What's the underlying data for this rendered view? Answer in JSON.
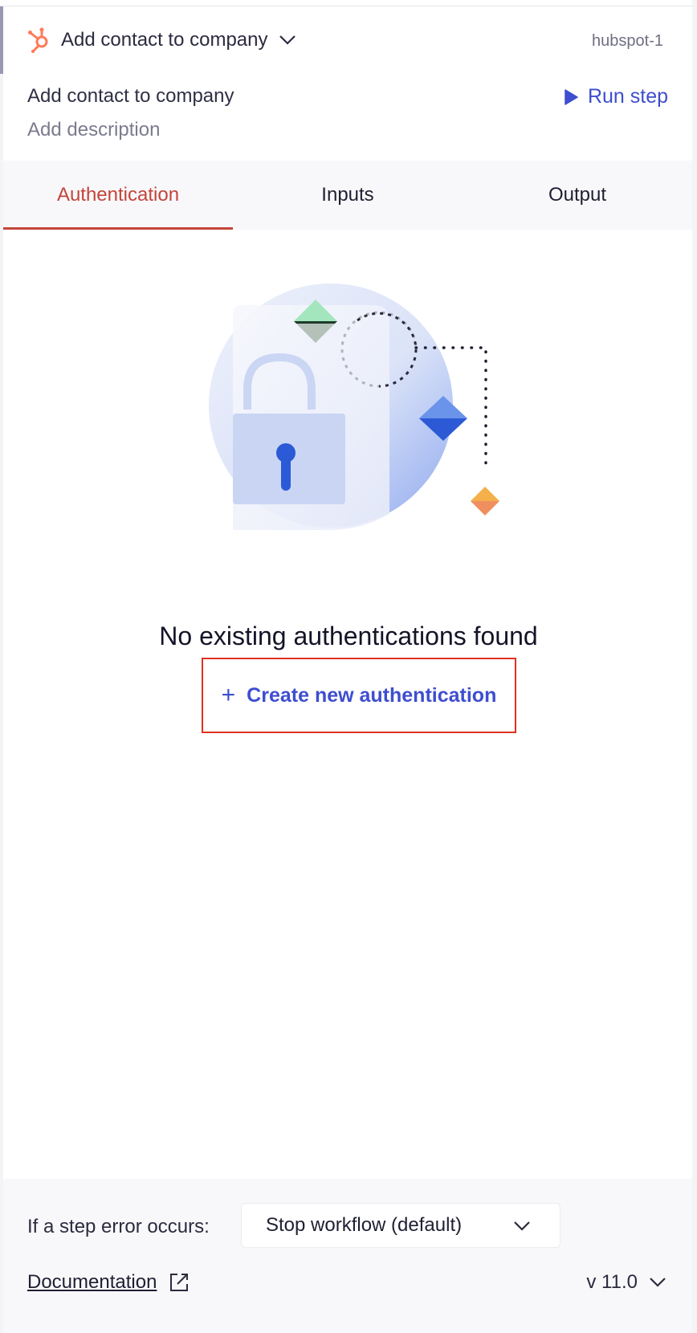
{
  "header": {
    "step_title": "Add contact to company",
    "step_id": "hubspot-1",
    "logo_icon": "hubspot-icon",
    "brand_color": "#ff7a59"
  },
  "step": {
    "name": "Add contact to company",
    "description_placeholder": "Add description",
    "run_label": "Run step"
  },
  "tabs": [
    {
      "label": "Authentication",
      "active": true
    },
    {
      "label": "Inputs",
      "active": false
    },
    {
      "label": "Output",
      "active": false
    }
  ],
  "empty_state": {
    "title": "No existing authentications found",
    "create_label": "Create new authentication",
    "illustration": "lock-illustration"
  },
  "footer": {
    "error_label": "If a step error occurs:",
    "error_option": "Stop workflow (default)",
    "documentation_label": "Documentation",
    "version": "v 11.0"
  },
  "colors": {
    "accent": "#3e4ecf",
    "active_tab": "#c4453a",
    "highlight_box": "#e0321f"
  }
}
